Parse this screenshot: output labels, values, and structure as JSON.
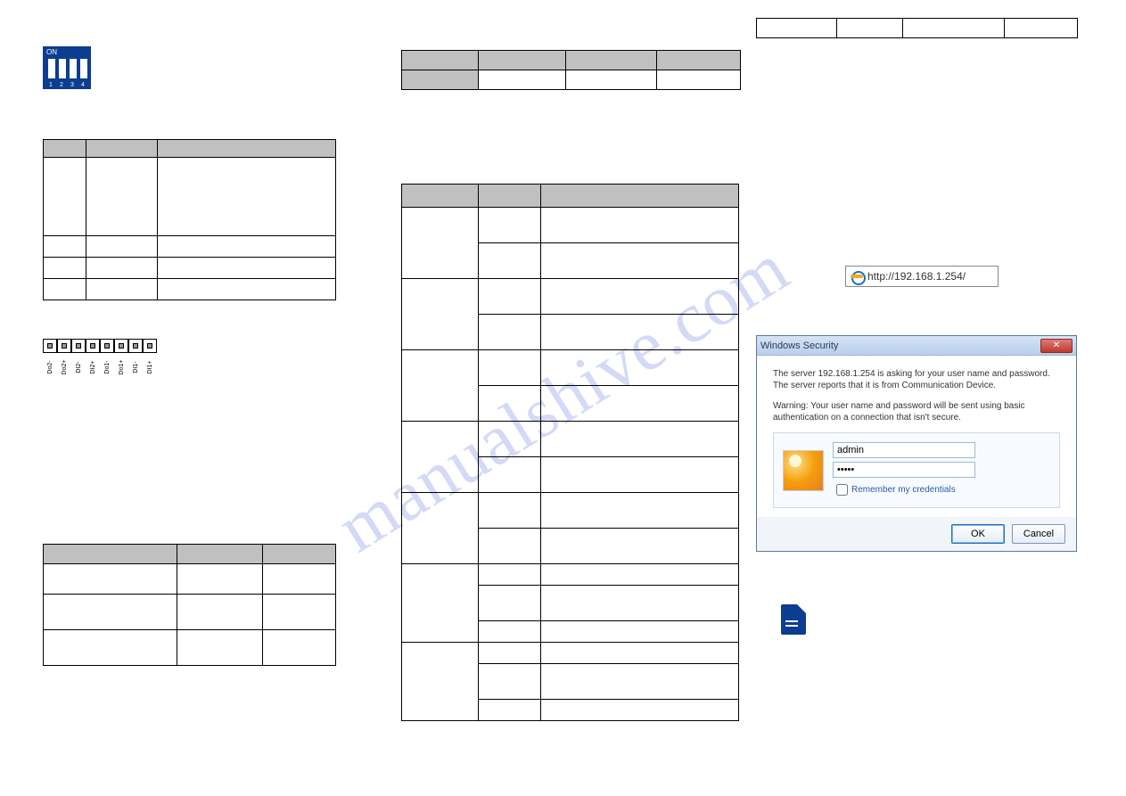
{
  "watermark": "manualshive.com",
  "dip": {
    "on": "ON",
    "n1": "1",
    "n2": "2",
    "n3": "3",
    "n4": "4"
  },
  "terminal_labels": [
    "Do2-",
    "Do2+",
    "DI2-",
    "DI2+",
    "Do1-",
    "Do1+",
    "DI1-",
    "DI1+"
  ],
  "addrbar_url": "http://192.168.1.254/",
  "win": {
    "title": "Windows Security",
    "p1": "The server 192.168.1.254 is asking for your user name and password. The server reports that it is from Communication Device.",
    "p2": "Warning: Your user name and password will be sent using basic authentication on a connection that isn't secure.",
    "user": "admin",
    "pass": "•••••",
    "remember": "Remember my credentials",
    "ok": "OK",
    "cancel": "Cancel",
    "close": "✕"
  }
}
